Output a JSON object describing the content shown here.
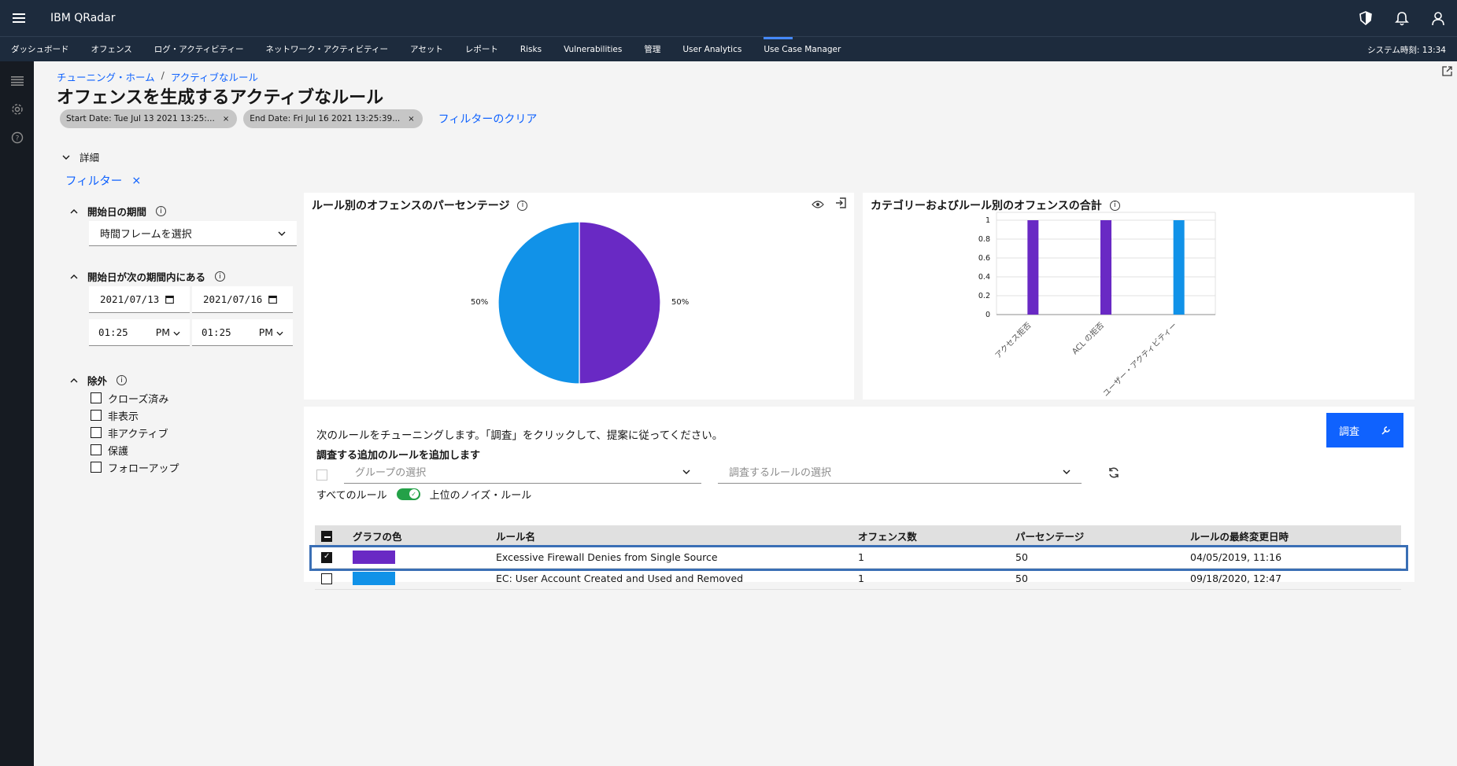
{
  "app": {
    "title": "IBM QRadar"
  },
  "nav": {
    "items": [
      "ダッシュボード",
      "オフェンス",
      "ログ・アクティビティー",
      "ネットワーク・アクティビティー",
      "アセット",
      "レポート",
      "Risks",
      "Vulnerabilities",
      "管理",
      "User Analytics",
      "Use Case Manager"
    ],
    "active": "Use Case Manager",
    "system_time": "システム時刻: 13:34"
  },
  "breadcrumb": {
    "home": "チューニング・ホーム",
    "separator": "/",
    "current": "アクティブなルール"
  },
  "page": {
    "title": "オフェンスを生成するアクティブなルール"
  },
  "chips": {
    "start": "Start Date: Tue Jul 13 2021 13:25:...",
    "end": "End Date: Fri Jul 16 2021 13:25:39...",
    "close": "×",
    "clear": "フィルターのクリア"
  },
  "details": {
    "label": "詳細"
  },
  "filter": {
    "label": "フィルター",
    "close": "×"
  },
  "facets": {
    "start_period": {
      "title": "開始日の期間",
      "select": "時間フレームを選択"
    },
    "start_between": {
      "title": "開始日が次の期間内にある",
      "from_date": "2021/07/13",
      "to_date": "2021/07/16",
      "from_time": "01:25",
      "to_time": "01:25",
      "from_ampm": "PM",
      "to_ampm": "PM"
    },
    "exclude": {
      "title": "除外",
      "options": [
        "クローズ済み",
        "非表示",
        "非アクティブ",
        "保護",
        "フォローアップ"
      ]
    }
  },
  "pie_card": {
    "title": "ルール別のオフェンスのパーセンテージ",
    "left_label": "50%",
    "right_label": "50%"
  },
  "bar_card": {
    "title": "カテゴリーおよびルール別のオフェンスの合計"
  },
  "colors": {
    "purple": "#6929c4",
    "blue": "#1192e8",
    "accent": "#0f62fe",
    "header": "#1d2b3d"
  },
  "chart_data": [
    {
      "type": "pie",
      "title": "ルール別のオフェンスのパーセンテージ",
      "labels": [
        "Excessive Firewall Denies from Single Source",
        "EC: User Account Created and Used and Removed"
      ],
      "values": [
        50,
        50
      ],
      "colors": [
        "#6929c4",
        "#1192e8"
      ]
    },
    {
      "type": "bar",
      "title": "カテゴリーおよびルール別のオフェンスの合計",
      "categories": [
        "アクセス拒否",
        "ACL の拒否",
        "ユーザー・アクティビティー"
      ],
      "values": [
        1,
        1,
        1
      ],
      "colors": [
        "#6929c4",
        "#6929c4",
        "#1192e8"
      ],
      "ylim": [
        0,
        1
      ],
      "yticks": [
        "0",
        "0.2",
        "0.4",
        "0.6",
        "0.8",
        "1"
      ],
      "grid": true
    }
  ],
  "tuning": {
    "instruction": "次のルールをチューニングします。「調査」をクリックして、提案に従ってください。",
    "investigate_button": "調査",
    "add_rules_label": "調査する追加のルールを追加します",
    "group_placeholder": "グループの選択",
    "rule_placeholder": "調査するルールの選択",
    "all_rules": "すべてのルール",
    "top_noise": "上位のノイズ・ルール"
  },
  "table": {
    "headers": [
      "グラフの色",
      "ルール名",
      "オフェンス数",
      "パーセンテージ",
      "ルールの最終変更日時"
    ],
    "rows": [
      {
        "checked": true,
        "color": "#6929c4",
        "name": "Excessive Firewall Denies from Single Source",
        "count": "1",
        "percent": "50",
        "modified": "04/05/2019, 11:16"
      },
      {
        "checked": false,
        "color": "#1192e8",
        "name": "EC: User Account Created and Used and Removed",
        "count": "1",
        "percent": "50",
        "modified": "09/18/2020, 12:47"
      }
    ]
  }
}
